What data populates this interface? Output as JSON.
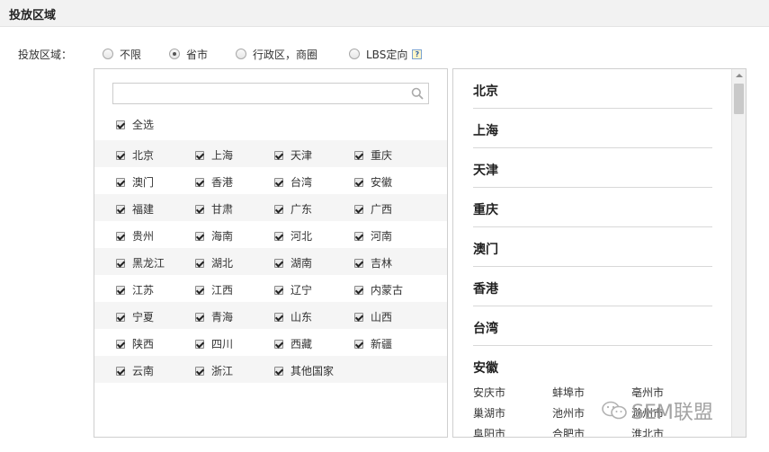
{
  "section": {
    "title": "投放区域"
  },
  "region": {
    "label": "投放区域：",
    "options": [
      {
        "label": "不限",
        "checked": false
      },
      {
        "label": "省市",
        "checked": true
      },
      {
        "label": "行政区，商圈",
        "checked": false
      },
      {
        "label": "LBS定向",
        "checked": false,
        "help_icon": "question-icon"
      }
    ]
  },
  "search": {
    "value": "",
    "placeholder": ""
  },
  "select_all": {
    "label": "全选",
    "checked": true
  },
  "provinces": [
    [
      "北京",
      "上海",
      "天津",
      "重庆"
    ],
    [
      "澳门",
      "香港",
      "台湾",
      "安徽"
    ],
    [
      "福建",
      "甘肃",
      "广东",
      "广西"
    ],
    [
      "贵州",
      "海南",
      "河北",
      "河南"
    ],
    [
      "黑龙江",
      "湖北",
      "湖南",
      "吉林"
    ],
    [
      "江苏",
      "江西",
      "辽宁",
      "内蒙古"
    ],
    [
      "宁夏",
      "青海",
      "山东",
      "山西"
    ],
    [
      "陕西",
      "四川",
      "西藏",
      "新疆"
    ],
    [
      "云南",
      "浙江",
      "其他国家"
    ]
  ],
  "selected_areas": [
    {
      "name": "北京",
      "cities": []
    },
    {
      "name": "上海",
      "cities": []
    },
    {
      "name": "天津",
      "cities": []
    },
    {
      "name": "重庆",
      "cities": []
    },
    {
      "name": "澳门",
      "cities": []
    },
    {
      "name": "香港",
      "cities": []
    },
    {
      "name": "台湾",
      "cities": []
    },
    {
      "name": "安徽",
      "cities": [
        "安庆市",
        "蚌埠市",
        "亳州市",
        "巢湖市",
        "池州市",
        "滁州市",
        "阜阳市",
        "合肥市",
        "淮北市"
      ]
    }
  ],
  "watermark": {
    "text": "SEM联盟",
    "icon": "wechat-icon"
  },
  "colors": {
    "header_bg": "#f2f2f2",
    "border": "#cfcfcf",
    "row_shade": "#f5f5f5"
  }
}
